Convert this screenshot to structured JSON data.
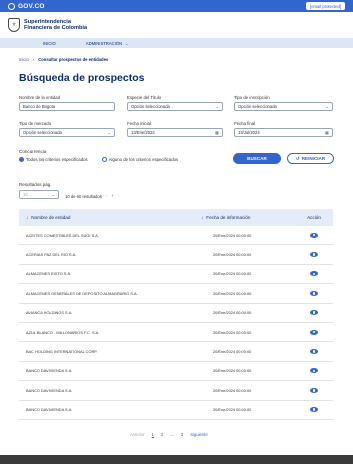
{
  "gov": {
    "logo": "GOV.CO",
    "email": "[email protected]"
  },
  "brand": {
    "line1": "Superintendencia",
    "line2": "Financiera de Colombia",
    "shield": "⚜"
  },
  "nav": {
    "items": [
      {
        "label": "INICIO"
      },
      {
        "label": "ADMINISTRACIÓN"
      }
    ]
  },
  "breadcrumb": {
    "home": "Inicio",
    "current": "Consultar prospectos de entidades"
  },
  "page": {
    "title": "Búsqueda de prospectos"
  },
  "filters": {
    "nombre": {
      "label": "Nombre de la entidad",
      "value": "Banco de Bogota"
    },
    "especie": {
      "label": "Especie del Título",
      "value": "Opción seleccionada"
    },
    "inscripcion": {
      "label": "Tipo de inscripción",
      "value": "Opción seleccionada"
    },
    "mercado": {
      "label": "Tipo de mercado",
      "value": "Opción seleccionada"
    },
    "fecha_inicial": {
      "label": "Fecha inicial",
      "value": "13/Ene/2024"
    },
    "fecha_final": {
      "label": "Fecha final",
      "value": "13/Jul/2024"
    }
  },
  "concurrencia": {
    "label": "Concurrencia",
    "options": [
      {
        "label": "Todos los criterios especificados",
        "selected": true
      },
      {
        "label": "Alguno de los criterios especificados",
        "selected": false
      }
    ]
  },
  "buttons": {
    "search": "BUSCAR",
    "reset": "REINICIAR"
  },
  "results": {
    "label": "Resultados pág.",
    "per_page": "10",
    "info": "10 de 60 resultados"
  },
  "table": {
    "headers": {
      "name": "Nombre de entidad",
      "date": "Fecha de información",
      "action": "Acción"
    },
    "rows": [
      {
        "name": "ACEITES COMESTIBLES DEL SUGI S.A.",
        "date": "20/Ene/2024 00:00:00"
      },
      {
        "name": "ACERIAS PAZ DEL RIO S.A.",
        "date": "20/Ene/2024 00:00:00"
      },
      {
        "name": "ALMACENES EXITO S.A.",
        "date": "20/Ene/2024 00:00:00"
      },
      {
        "name": "ALMACENES GENERALES DE DEPOSITO ALMAGRARIO S.A.",
        "date": "20/Ene/2024 00:00:00"
      },
      {
        "name": "AVIANCA HOLDINGS S.A.",
        "date": "20/Ene/2024 00:00:00"
      },
      {
        "name": "AZUL BLANCO - MILLONARIOS F.C. S.A.",
        "date": "20/Ene/2024 00:00:00"
      },
      {
        "name": "BAC HOLDING INTERNATIONAL CORP.",
        "date": "20/Ene/2024 00:00:00"
      },
      {
        "name": "BANCO DAVIVIENDA S.A.",
        "date": "20/Ene/2024 00:00:00"
      },
      {
        "name": "BANCO DAVIVIENDA S.A.",
        "date": "20/Ene/2024 00:00:00"
      },
      {
        "name": "BANCO DAVIVIENDA S.A.",
        "date": "20/Ene/2024 00:00:00"
      }
    ]
  },
  "pagination": {
    "prev": "Anterior",
    "pages": [
      "1",
      "2",
      "...",
      "3"
    ],
    "next": "Siguiente"
  }
}
